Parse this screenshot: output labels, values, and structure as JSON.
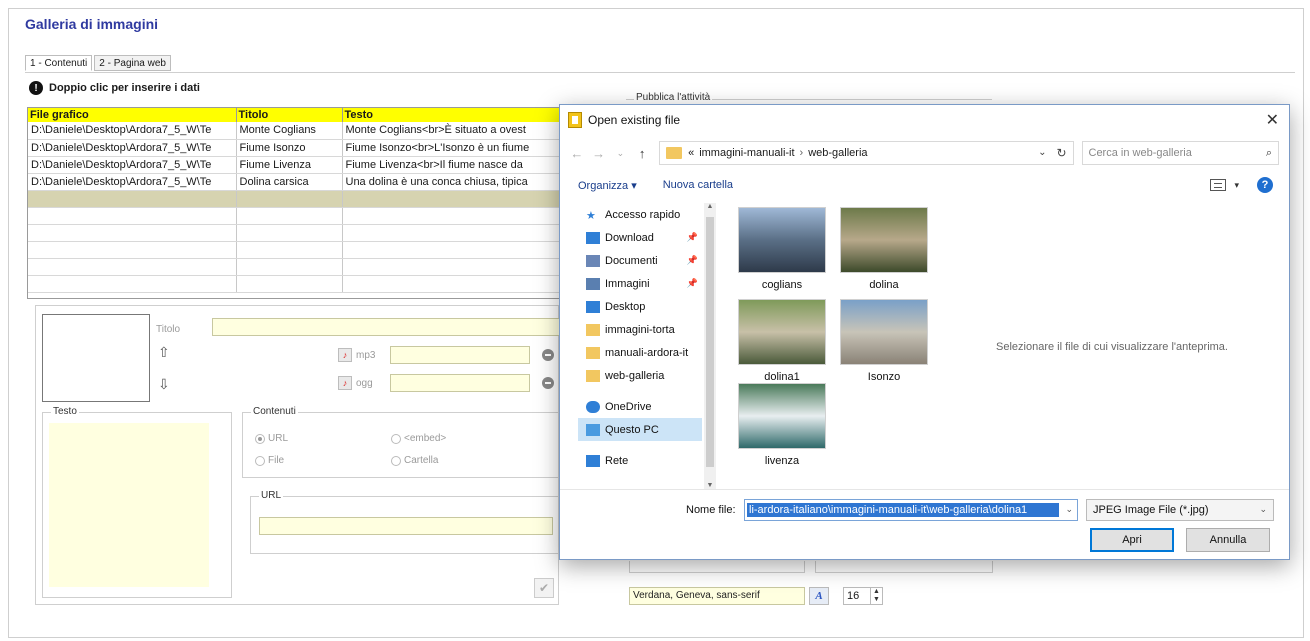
{
  "app": {
    "title": "Galleria di immagini",
    "tabs": [
      "1 - Contenuti",
      "2 - Pagina web"
    ],
    "hint": "Doppio clic per inserire i dati"
  },
  "grid": {
    "headers": [
      "File grafico",
      "Titolo",
      "Testo"
    ],
    "rows": [
      [
        "D:\\Daniele\\Desktop\\Ardora7_5_W\\Te",
        "Monte Coglians",
        "Monte Coglians<br>È situato a ovest"
      ],
      [
        "D:\\Daniele\\Desktop\\Ardora7_5_W\\Te",
        "Fiume Isonzo",
        "Fiume Isonzo<br>L'Isonzo è un fiume"
      ],
      [
        "D:\\Daniele\\Desktop\\Ardora7_5_W\\Te",
        "Fiume Livenza",
        "Fiume Livenza<br>Il fiume nasce da"
      ],
      [
        "D:\\Daniele\\Desktop\\Ardora7_5_W\\Te",
        "Dolina carsica",
        "Una dolina è una conca chiusa, tipica"
      ]
    ]
  },
  "panel": {
    "titolo_label": "Titolo",
    "mp3_label": "mp3",
    "ogg_label": "ogg",
    "testo_label": "Testo",
    "contenuti_label": "Contenuti",
    "radio_url": "URL",
    "radio_embed": "<embed>",
    "radio_file": "File",
    "radio_cartella": "Cartella",
    "url_label": "URL"
  },
  "right": {
    "pubblica_label": "Pubblica l'attività",
    "font_value": "Verdana, Geneva, sans-serif",
    "font_size": "16"
  },
  "dialog": {
    "title": "Open existing file",
    "path_prefix": "«",
    "path": [
      "immagini-manuali-it",
      "web-galleria"
    ],
    "search_placeholder": "Cerca in web-galleria",
    "organizza": "Organizza ▾",
    "nuova_cartella": "Nuova cartella",
    "tree": [
      {
        "label": "Accesso rapido",
        "icon": "star-icon",
        "color": "#2f7fd6"
      },
      {
        "label": "Download",
        "icon": "download-icon",
        "color": "#2f7fd6",
        "pinned": true
      },
      {
        "label": "Documenti",
        "icon": "document-icon",
        "color": "#6a86b6",
        "pinned": true
      },
      {
        "label": "Immagini",
        "icon": "image-icon",
        "color": "#5a7fb0",
        "pinned": true
      },
      {
        "label": "Desktop",
        "icon": "desktop-icon",
        "color": "#2f7fd6"
      },
      {
        "label": "immagini-torta",
        "icon": "folder-icon",
        "color": "#f2c760"
      },
      {
        "label": "manuali-ardora-it",
        "icon": "folder-icon",
        "color": "#f2c760"
      },
      {
        "label": "web-galleria",
        "icon": "folder-icon",
        "color": "#f2c760"
      },
      {
        "label": "OneDrive",
        "icon": "cloud-icon",
        "color": "#2f7fd6"
      },
      {
        "label": "Questo PC",
        "icon": "computer-icon",
        "color": "#4a9be0",
        "selected": true
      },
      {
        "label": "Rete",
        "icon": "network-icon",
        "color": "#2f7fd6"
      }
    ],
    "files": [
      {
        "name": "coglians",
        "colors": [
          "#9fb8d6",
          "#5a6f86",
          "#2e3a4a"
        ]
      },
      {
        "name": "dolina",
        "colors": [
          "#6d7a4a",
          "#b7a88a",
          "#3d4a2a"
        ]
      },
      {
        "name": "dolina1",
        "colors": [
          "#7f9a5a",
          "#c8c0a8",
          "#4a5a3a"
        ]
      },
      {
        "name": "Isonzo",
        "colors": [
          "#7aa0c8",
          "#c8c4b8",
          "#8a8276"
        ]
      },
      {
        "name": "livenza",
        "colors": [
          "#4a7a5a",
          "#e8eef0",
          "#2f6a6a"
        ]
      }
    ],
    "preview_msg": "Selezionare il file di cui visualizzare l'anteprima.",
    "filename_label": "Nome file:",
    "filename_value": "li-ardora-italiano\\immagini-manuali-it\\web-galleria\\dolina1",
    "filetype": "JPEG Image File (*.jpg)",
    "open_button": "Apri",
    "cancel_button": "Annulla"
  }
}
